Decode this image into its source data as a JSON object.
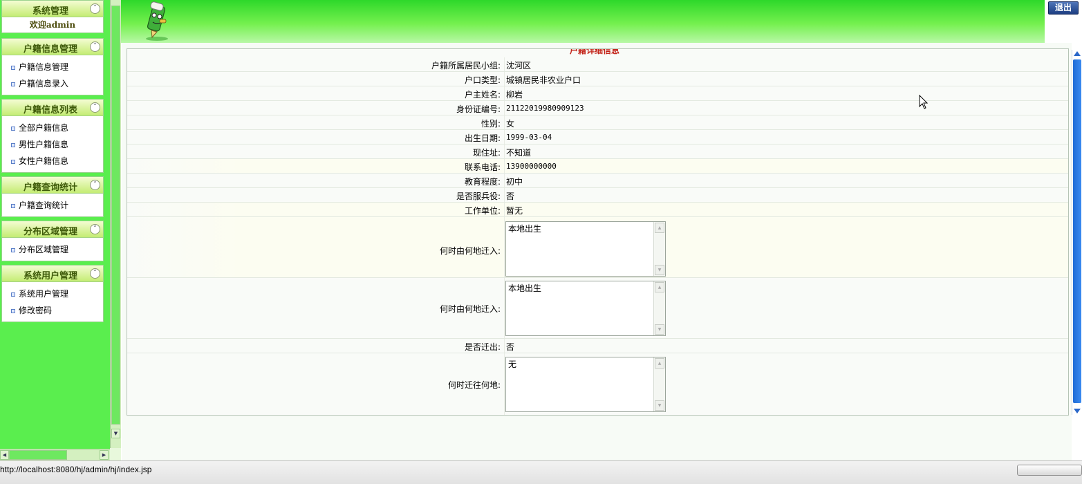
{
  "sidebar": {
    "groups": [
      {
        "title": "系统管理",
        "welcome": "欢迎admin"
      },
      {
        "title": "户籍信息管理",
        "items": [
          "户籍信息管理",
          "户籍信息录入"
        ]
      },
      {
        "title": "户籍信息列表",
        "items": [
          "全部户籍信息",
          "男性户籍信息",
          "女性户籍信息"
        ]
      },
      {
        "title": "户籍查询统计",
        "items": [
          "户籍查询统计"
        ]
      },
      {
        "title": "分布区域管理",
        "items": [
          "分布区域管理"
        ]
      },
      {
        "title": "系统用户管理",
        "items": [
          "系统用户管理",
          "修改密码"
        ]
      }
    ],
    "collapse_glyph": "˄"
  },
  "header": {
    "logout_label": "退出"
  },
  "detail": {
    "title": "户籍详细信息",
    "rows": [
      {
        "label": "户籍所属居民小组:",
        "value": "沈河区"
      },
      {
        "label": "户口类型:",
        "value": "城镇居民非农业户口"
      },
      {
        "label": "户主姓名:",
        "value": "柳岩"
      },
      {
        "label": "身份证编号:",
        "value": "21122019980909123"
      },
      {
        "label": "性别:",
        "value": "女"
      },
      {
        "label": "出生日期:",
        "value": "1999-03-04"
      },
      {
        "label": "现住址:",
        "value": "不知道"
      },
      {
        "label": "联系电话:",
        "value": "13900000000"
      },
      {
        "label": "教育程度:",
        "value": "初中"
      },
      {
        "label": "是否服兵役:",
        "value": "否"
      },
      {
        "label": "工作单位:",
        "value": "暂无"
      },
      {
        "label": "何时由何地迁入:",
        "value": "本地出生"
      },
      {
        "label": "何时由何地迁入:",
        "value": "本地出生"
      },
      {
        "label": "是否迁出:",
        "value": "否"
      },
      {
        "label": "何时迁往何地:",
        "value": "无"
      }
    ]
  },
  "statusbar": {
    "text": "http://localhost:8080/hj/admin/hj/index.jsp"
  },
  "icons": {
    "menu": "bullet-icon",
    "collapse": "collapse-up-icon",
    "mascot": "pencil-mascot-icon",
    "cursor": "mouse-cursor-icon"
  },
  "colors": {
    "sidebar_bg": "#5aee4e",
    "banner_top": "#2ed82a",
    "header_text": "#3e5a0a",
    "title_red": "#c3241a",
    "logout_bg": "#1d3e82"
  }
}
